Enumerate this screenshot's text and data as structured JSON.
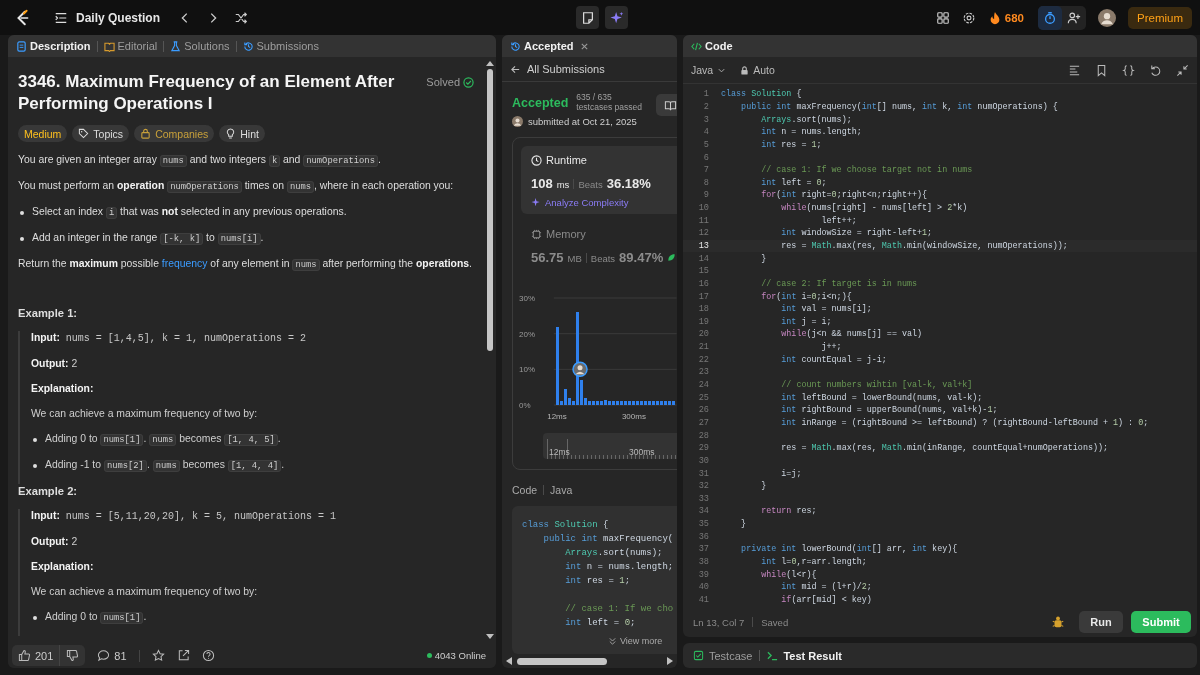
{
  "topbar": {
    "title": "Daily Question",
    "streak": "680",
    "premium": "Premium"
  },
  "left_tabs": [
    {
      "kind": "description",
      "label": "Description",
      "selected": true
    },
    {
      "kind": "editorial",
      "label": "Editorial",
      "selected": false
    },
    {
      "kind": "solutions",
      "label": "Solutions",
      "selected": false
    },
    {
      "kind": "submissions",
      "label": "Submissions",
      "selected": false
    }
  ],
  "problem": {
    "title": "3346. Maximum Frequency of an Element After Performing Operations I",
    "status": "Solved",
    "tags": [
      {
        "kind": "difficulty",
        "label": "Medium"
      },
      {
        "kind": "topics",
        "label": "Topics"
      },
      {
        "kind": "companies",
        "label": "Companies"
      },
      {
        "kind": "hint",
        "label": "Hint"
      }
    ],
    "blocks": [
      {
        "kind": "para",
        "parts": [
          {
            "kind": "text",
            "text": "You are given an integer array "
          },
          {
            "kind": "code",
            "text": "nums"
          },
          {
            "kind": "text",
            "text": " and two integers "
          },
          {
            "kind": "code",
            "text": "k"
          },
          {
            "kind": "text",
            "text": " and "
          },
          {
            "kind": "code",
            "text": "numOperations"
          },
          {
            "kind": "text",
            "text": "."
          }
        ]
      },
      {
        "kind": "para",
        "parts": [
          {
            "kind": "text",
            "text": "You must perform an "
          },
          {
            "kind": "bold",
            "text": "operation "
          },
          {
            "kind": "code",
            "text": "numOperations"
          },
          {
            "kind": "text",
            "text": " times on "
          },
          {
            "kind": "code",
            "text": "nums"
          },
          {
            "kind": "text",
            "text": ", where in each operation you:"
          }
        ]
      },
      {
        "kind": "bullet",
        "parts": [
          {
            "kind": "text",
            "text": "Select an index "
          },
          {
            "kind": "code",
            "text": "i"
          },
          {
            "kind": "text",
            "text": " that was "
          },
          {
            "kind": "bold",
            "text": "not"
          },
          {
            "kind": "text",
            "text": " selected in any previous operations."
          }
        ]
      },
      {
        "kind": "bullet",
        "parts": [
          {
            "kind": "text",
            "text": "Add an integer in the range "
          },
          {
            "kind": "code",
            "text": "[-k, k]"
          },
          {
            "kind": "text",
            "text": " to "
          },
          {
            "kind": "code",
            "text": "nums[i]"
          },
          {
            "kind": "text",
            "text": "."
          }
        ]
      },
      {
        "kind": "para",
        "parts": [
          {
            "kind": "text",
            "text": "Return the "
          },
          {
            "kind": "bold",
            "text": "maximum"
          },
          {
            "kind": "text",
            "text": " possible "
          },
          {
            "kind": "link",
            "text": "frequency"
          },
          {
            "kind": "text",
            "text": " of any element in "
          },
          {
            "kind": "code",
            "text": "nums"
          },
          {
            "kind": "text",
            "text": " after performing the "
          },
          {
            "kind": "bold",
            "text": "operations"
          },
          {
            "kind": "text",
            "text": "."
          }
        ]
      },
      {
        "kind": "heading",
        "text": "Example 1:"
      },
      {
        "kind": "example",
        "blocks": [
          {
            "kind": "para",
            "parts": [
              {
                "kind": "bold",
                "text": "Input:"
              },
              {
                "kind": "mono",
                "text": " nums = [1,4,5], k = 1, numOperations = 2"
              }
            ]
          },
          {
            "kind": "para",
            "parts": [
              {
                "kind": "bold",
                "text": "Output:"
              },
              {
                "kind": "text",
                "text": " 2"
              }
            ]
          },
          {
            "kind": "para",
            "parts": [
              {
                "kind": "bold",
                "text": "Explanation:"
              }
            ]
          },
          {
            "kind": "para",
            "parts": [
              {
                "kind": "text",
                "text": "We can achieve a maximum frequency of two by:"
              }
            ]
          },
          {
            "kind": "bullet",
            "parts": [
              {
                "kind": "text",
                "text": "Adding 0 to "
              },
              {
                "kind": "code",
                "text": "nums[1]"
              },
              {
                "kind": "text",
                "text": ". "
              },
              {
                "kind": "code",
                "text": "nums"
              },
              {
                "kind": "text",
                "text": " becomes "
              },
              {
                "kind": "code",
                "text": "[1, 4, 5]"
              },
              {
                "kind": "text",
                "text": "."
              }
            ]
          },
          {
            "kind": "bullet",
            "parts": [
              {
                "kind": "text",
                "text": "Adding -1 to "
              },
              {
                "kind": "code",
                "text": "nums[2]"
              },
              {
                "kind": "text",
                "text": ". "
              },
              {
                "kind": "code",
                "text": "nums"
              },
              {
                "kind": "text",
                "text": " becomes "
              },
              {
                "kind": "code",
                "text": "[1, 4, 4]"
              },
              {
                "kind": "text",
                "text": "."
              }
            ]
          }
        ]
      },
      {
        "kind": "heading",
        "text": "Example 2:"
      },
      {
        "kind": "example",
        "blocks": [
          {
            "kind": "para",
            "parts": [
              {
                "kind": "bold",
                "text": "Input:"
              },
              {
                "kind": "mono",
                "text": " nums = [5,11,20,20], k = 5, numOperations = 1"
              }
            ]
          },
          {
            "kind": "para",
            "parts": [
              {
                "kind": "bold",
                "text": "Output:"
              },
              {
                "kind": "text",
                "text": " 2"
              }
            ]
          },
          {
            "kind": "para",
            "parts": [
              {
                "kind": "bold",
                "text": "Explanation:"
              }
            ]
          },
          {
            "kind": "para",
            "parts": [
              {
                "kind": "text",
                "text": "We can achieve a maximum frequency of two by:"
              }
            ]
          },
          {
            "kind": "bullet",
            "parts": [
              {
                "kind": "text",
                "text": "Adding 0 to "
              },
              {
                "kind": "code",
                "text": "nums[1]"
              },
              {
                "kind": "text",
                "text": "."
              }
            ]
          }
        ]
      }
    ]
  },
  "left_footer": {
    "likes": "201",
    "comments": "81",
    "online": "4043 Online"
  },
  "submission": {
    "tab": "Accepted",
    "back": "All Submissions",
    "status": "Accepted",
    "count": "635 / 635",
    "count_label": "testcases passed",
    "submitted": "submitted at Oct 21, 2025",
    "metrics": [
      {
        "kind": "runtime",
        "title": "Runtime",
        "value": "108",
        "unit": "ms",
        "beats_label": "Beats",
        "beats": "36.18%",
        "selected": true
      },
      {
        "kind": "memory",
        "title": "Memory",
        "value": "56.75",
        "unit": "MB",
        "beats_label": "Beats",
        "beats": "89.47%",
        "selected": false
      }
    ],
    "analyze": "Analyze Complexity",
    "chart_data": {
      "type": "bar",
      "x": [
        12,
        27,
        42,
        57,
        72,
        87,
        102,
        117,
        132,
        147,
        162,
        177,
        192,
        207,
        222,
        237,
        252,
        267,
        282,
        297,
        312,
        327,
        342,
        357,
        372,
        387,
        402,
        417,
        432,
        447
      ],
      "values": [
        22,
        1,
        4.5,
        2,
        1,
        26,
        7,
        2,
        1,
        1,
        1,
        1,
        1.5,
        1,
        1,
        1,
        1,
        1,
        1,
        1,
        1,
        1,
        1,
        1,
        1,
        1,
        1,
        1,
        1,
        1
      ],
      "xlim": [
        0,
        460
      ],
      "ylim": [
        0,
        30
      ],
      "yticks": [
        {
          "value": 0,
          "label": "0%"
        },
        {
          "value": 10,
          "label": "10%"
        },
        {
          "value": 20,
          "label": "20%"
        },
        {
          "value": 30,
          "label": "30%"
        }
      ],
      "xticks": [
        {
          "value": 12,
          "label": "12ms"
        },
        {
          "value": 300,
          "label": "300ms"
        }
      ]
    },
    "range_labels": [
      "12ms",
      "300ms"
    ],
    "code_label": "Code",
    "language": "Java",
    "code": [
      {
        "kind": "code",
        "parts": [
          {
            "kind": "kw",
            "text": "class"
          },
          {
            "kind": "ty",
            "text": " Solution"
          },
          {
            "kind": "pl",
            "text": " {"
          }
        ]
      },
      {
        "kind": "code",
        "parts": [
          {
            "kind": "kw",
            "text": "    public int"
          },
          {
            "kind": "pl",
            "text": " maxFrequency("
          }
        ]
      },
      {
        "kind": "code",
        "parts": [
          {
            "kind": "ty",
            "text": "        Arrays"
          },
          {
            "kind": "pl",
            "text": ".sort(nums);"
          }
        ]
      },
      {
        "kind": "code",
        "parts": [
          {
            "kind": "kw",
            "text": "        int"
          },
          {
            "kind": "pl",
            "text": " n = nums.length;"
          }
        ]
      },
      {
        "kind": "code",
        "parts": [
          {
            "kind": "kw",
            "text": "        int"
          },
          {
            "kind": "pl",
            "text": " res = "
          },
          {
            "kind": "num",
            "text": "1"
          },
          {
            "kind": "pl",
            "text": ";"
          }
        ]
      },
      {
        "kind": "blank"
      },
      {
        "kind": "code",
        "parts": [
          {
            "kind": "cm",
            "text": "        // case 1: If we cho"
          }
        ]
      },
      {
        "kind": "code",
        "parts": [
          {
            "kind": "kw",
            "text": "        int"
          },
          {
            "kind": "pl",
            "text": " left = "
          },
          {
            "kind": "num",
            "text": "0"
          },
          {
            "kind": "pl",
            "text": ";"
          }
        ]
      }
    ],
    "view_more": "View more"
  },
  "editor": {
    "title": "Code",
    "language": "Java",
    "mode": "Auto",
    "position": "Ln 13, Col 7",
    "saved": "Saved",
    "run": "Run",
    "submit": "Submit",
    "lines": [
      {
        "n": "1",
        "current": false,
        "code": [
          {
            "kind": "kw",
            "text": "class"
          },
          {
            "kind": "ty",
            "text": " Solution"
          },
          {
            "kind": "pl",
            "text": " {"
          }
        ]
      },
      {
        "n": "2",
        "current": false,
        "code": [
          {
            "kind": "kw",
            "text": "    public int"
          },
          {
            "kind": "pl",
            "text": " maxFrequency("
          },
          {
            "kind": "kw",
            "text": "int"
          },
          {
            "kind": "pl",
            "text": "[] nums, "
          },
          {
            "kind": "kw",
            "text": "int"
          },
          {
            "kind": "pl",
            "text": " k, "
          },
          {
            "kind": "kw",
            "text": "int"
          },
          {
            "kind": "pl",
            "text": " numOperations) {"
          }
        ]
      },
      {
        "n": "3",
        "current": false,
        "code": [
          {
            "kind": "ty",
            "text": "        Arrays"
          },
          {
            "kind": "pl",
            "text": ".sort(nums);"
          }
        ]
      },
      {
        "n": "4",
        "current": false,
        "code": [
          {
            "kind": "kw",
            "text": "        int"
          },
          {
            "kind": "pl",
            "text": " n = nums.length;"
          }
        ]
      },
      {
        "n": "5",
        "current": false,
        "code": [
          {
            "kind": "kw",
            "text": "        int"
          },
          {
            "kind": "pl",
            "text": " res = "
          },
          {
            "kind": "num",
            "text": "1"
          },
          {
            "kind": "pl",
            "text": ";"
          }
        ]
      },
      {
        "n": "6",
        "current": false
      },
      {
        "n": "7",
        "current": false,
        "code": [
          {
            "kind": "cm",
            "text": "        // case 1: If we choose target not in nums"
          }
        ]
      },
      {
        "n": "8",
        "current": false,
        "code": [
          {
            "kind": "kw",
            "text": "        int"
          },
          {
            "kind": "pl",
            "text": " left = "
          },
          {
            "kind": "num",
            "text": "0"
          },
          {
            "kind": "pl",
            "text": ";"
          }
        ]
      },
      {
        "n": "9",
        "current": false,
        "code": [
          {
            "kind": "ctl",
            "text": "        for"
          },
          {
            "kind": "pl",
            "text": "("
          },
          {
            "kind": "kw",
            "text": "int"
          },
          {
            "kind": "pl",
            "text": " right="
          },
          {
            "kind": "num",
            "text": "0"
          },
          {
            "kind": "pl",
            "text": ";right<n;right++){"
          }
        ]
      },
      {
        "n": "10",
        "current": false,
        "code": [
          {
            "kind": "ctl",
            "text": "            while"
          },
          {
            "kind": "pl",
            "text": "(nums[right] - nums[left] > "
          },
          {
            "kind": "num",
            "text": "2"
          },
          {
            "kind": "pl",
            "text": "*k)"
          }
        ]
      },
      {
        "n": "11",
        "current": false,
        "code": [
          {
            "kind": "pl",
            "text": "                    left++;"
          }
        ]
      },
      {
        "n": "12",
        "current": false,
        "code": [
          {
            "kind": "kw",
            "text": "            int"
          },
          {
            "kind": "pl",
            "text": " windowSize = right-left+"
          },
          {
            "kind": "num",
            "text": "1"
          },
          {
            "kind": "pl",
            "text": ";"
          }
        ]
      },
      {
        "n": "13",
        "current": true,
        "code": [
          {
            "kind": "pl",
            "text": "            res = "
          },
          {
            "kind": "ty",
            "text": "Math"
          },
          {
            "kind": "pl",
            "text": ".max(res, "
          },
          {
            "kind": "ty",
            "text": "Math"
          },
          {
            "kind": "pl",
            "text": ".min(windowSize, numOperations));"
          }
        ]
      },
      {
        "n": "14",
        "current": false,
        "code": [
          {
            "kind": "pl",
            "text": "        }"
          }
        ]
      },
      {
        "n": "15",
        "current": false
      },
      {
        "n": "16",
        "current": false,
        "code": [
          {
            "kind": "cm",
            "text": "        // case 2: If target is in nums"
          }
        ]
      },
      {
        "n": "17",
        "current": false,
        "code": [
          {
            "kind": "ctl",
            "text": "        for"
          },
          {
            "kind": "pl",
            "text": "("
          },
          {
            "kind": "kw",
            "text": "int"
          },
          {
            "kind": "pl",
            "text": " i="
          },
          {
            "kind": "num",
            "text": "0"
          },
          {
            "kind": "pl",
            "text": ";i<n;){"
          }
        ]
      },
      {
        "n": "18",
        "current": false,
        "code": [
          {
            "kind": "kw",
            "text": "            int"
          },
          {
            "kind": "pl",
            "text": " val = nums[i];"
          }
        ]
      },
      {
        "n": "19",
        "current": false,
        "code": [
          {
            "kind": "kw",
            "text": "            int"
          },
          {
            "kind": "pl",
            "text": " j = i;"
          }
        ]
      },
      {
        "n": "20",
        "current": false,
        "code": [
          {
            "kind": "ctl",
            "text": "            while"
          },
          {
            "kind": "pl",
            "text": "(j<n && nums[j] == val)"
          }
        ]
      },
      {
        "n": "21",
        "current": false,
        "code": [
          {
            "kind": "pl",
            "text": "                    j++;"
          }
        ]
      },
      {
        "n": "22",
        "current": false,
        "code": [
          {
            "kind": "kw",
            "text": "            int"
          },
          {
            "kind": "pl",
            "text": " countEqual = j-i;"
          }
        ]
      },
      {
        "n": "23",
        "current": false
      },
      {
        "n": "24",
        "current": false,
        "code": [
          {
            "kind": "cm",
            "text": "            // count numbers wihtin [val-k, val+k]"
          }
        ]
      },
      {
        "n": "25",
        "current": false,
        "code": [
          {
            "kind": "kw",
            "text": "            int"
          },
          {
            "kind": "pl",
            "text": " leftBound = lowerBound(nums, val-k);"
          }
        ]
      },
      {
        "n": "26",
        "current": false,
        "code": [
          {
            "kind": "kw",
            "text": "            int"
          },
          {
            "kind": "pl",
            "text": " rightBound = upperBound(nums, val+k)-"
          },
          {
            "kind": "num",
            "text": "1"
          },
          {
            "kind": "pl",
            "text": ";"
          }
        ]
      },
      {
        "n": "27",
        "current": false,
        "code": [
          {
            "kind": "kw",
            "text": "            int"
          },
          {
            "kind": "pl",
            "text": " inRange = (rightBound >= leftBound) ? (rightBound-leftBound + "
          },
          {
            "kind": "num",
            "text": "1"
          },
          {
            "kind": "pl",
            "text": ") : "
          },
          {
            "kind": "num",
            "text": "0"
          },
          {
            "kind": "pl",
            "text": ";"
          }
        ]
      },
      {
        "n": "28",
        "current": false
      },
      {
        "n": "29",
        "current": false,
        "code": [
          {
            "kind": "pl",
            "text": "            res = "
          },
          {
            "kind": "ty",
            "text": "Math"
          },
          {
            "kind": "pl",
            "text": ".max(res, "
          },
          {
            "kind": "ty",
            "text": "Math"
          },
          {
            "kind": "pl",
            "text": ".min(inRange, countEqual+numOperations));"
          }
        ]
      },
      {
        "n": "30",
        "current": false
      },
      {
        "n": "31",
        "current": false,
        "code": [
          {
            "kind": "pl",
            "text": "            i=j;"
          }
        ]
      },
      {
        "n": "32",
        "current": false,
        "code": [
          {
            "kind": "pl",
            "text": "        }"
          }
        ]
      },
      {
        "n": "33",
        "current": false
      },
      {
        "n": "34",
        "current": false,
        "code": [
          {
            "kind": "ctl",
            "text": "        return"
          },
          {
            "kind": "pl",
            "text": " res;"
          }
        ]
      },
      {
        "n": "35",
        "current": false,
        "code": [
          {
            "kind": "pl",
            "text": "    }"
          }
        ]
      },
      {
        "n": "36",
        "current": false
      },
      {
        "n": "37",
        "current": false,
        "code": [
          {
            "kind": "kw",
            "text": "    private int"
          },
          {
            "kind": "pl",
            "text": " lowerBound("
          },
          {
            "kind": "kw",
            "text": "int"
          },
          {
            "kind": "pl",
            "text": "[] arr, "
          },
          {
            "kind": "kw",
            "text": "int"
          },
          {
            "kind": "pl",
            "text": " key){"
          }
        ]
      },
      {
        "n": "38",
        "current": false,
        "code": [
          {
            "kind": "kw",
            "text": "        int"
          },
          {
            "kind": "pl",
            "text": " l="
          },
          {
            "kind": "num",
            "text": "0"
          },
          {
            "kind": "pl",
            "text": ",r=arr.length;"
          }
        ]
      },
      {
        "n": "39",
        "current": false,
        "code": [
          {
            "kind": "ctl",
            "text": "        while"
          },
          {
            "kind": "pl",
            "text": "(l<r){"
          }
        ]
      },
      {
        "n": "40",
        "current": false,
        "code": [
          {
            "kind": "kw",
            "text": "            int"
          },
          {
            "kind": "pl",
            "text": " mid = (l+r)/"
          },
          {
            "kind": "num",
            "text": "2"
          },
          {
            "kind": "pl",
            "text": ";"
          }
        ]
      },
      {
        "n": "41",
        "current": false,
        "code": [
          {
            "kind": "ctl",
            "text": "            if"
          },
          {
            "kind": "pl",
            "text": "(arr[mid] < key)"
          }
        ]
      }
    ]
  },
  "bottom_tabs": [
    {
      "kind": "testcase",
      "label": "Testcase",
      "selected": false
    },
    {
      "kind": "result",
      "label": "Test Result",
      "selected": true
    }
  ]
}
